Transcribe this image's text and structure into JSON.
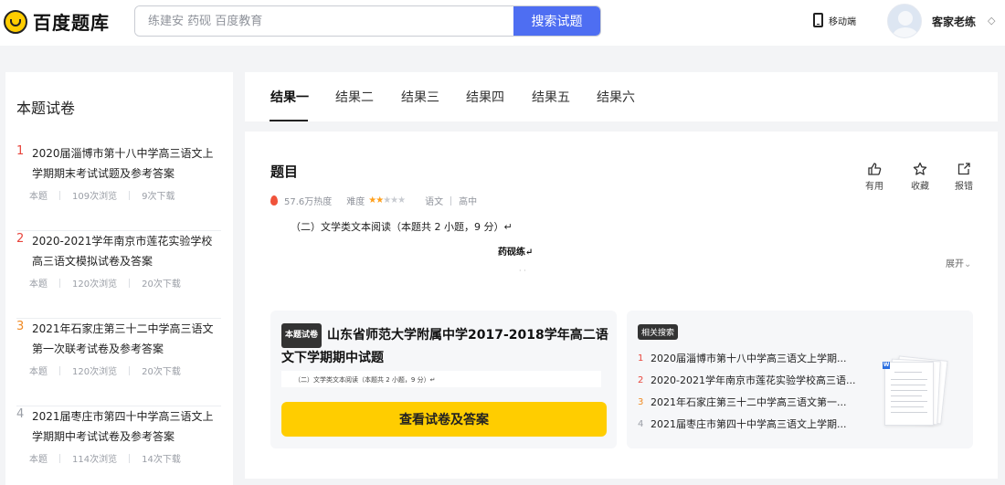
{
  "header": {
    "logo_text": "百度题库",
    "search_placeholder": "练建安 药砚 百度教育",
    "search_button": "搜索试题",
    "mobile_label": "移动端",
    "username": "客家老练"
  },
  "sidebar": {
    "title": "本题试卷",
    "items": [
      {
        "num": "1",
        "num_color": "#e8453c",
        "title": "2020届淄博市第十八中学高三语文上学期期末考试试题及参考答案",
        "type": "本题",
        "views": "109次浏览",
        "downloads": "9次下载"
      },
      {
        "num": "2",
        "num_color": "#e8453c",
        "title": "2020-2021学年南京市莲花实验学校高三语文模拟试卷及答案",
        "type": "本题",
        "views": "120次浏览",
        "downloads": "20次下载"
      },
      {
        "num": "3",
        "num_color": "#f08a24",
        "title": "2021年石家庄第三十二中学高三语文第一次联考试卷及参考答案",
        "type": "本题",
        "views": "120次浏览",
        "downloads": "20次下载"
      },
      {
        "num": "4",
        "num_color": "#9a9ea6",
        "title": "2021届枣庄市第四十中学高三语文上学期期中考试试卷及参考答案",
        "type": "本题",
        "views": "114次浏览",
        "downloads": "14次下载"
      }
    ]
  },
  "tabs": [
    "结果一",
    "结果二",
    "结果三",
    "结果四",
    "结果五",
    "结果六"
  ],
  "question": {
    "title": "题目",
    "heat": "57.6万热度",
    "difficulty_label": "难度",
    "difficulty_stars": 2,
    "difficulty_max": 5,
    "subject": "语文",
    "grade": "高中",
    "body": "（二）文学类文本阅读（本题共 2 小题，9 分）↵",
    "poem_title": "药砚练↵",
    "dots": "· ·",
    "expand": "展开",
    "actions": {
      "useful": "有用",
      "favorite": "收藏",
      "report": "报错"
    }
  },
  "exam_card": {
    "badge": "本题试卷",
    "title": "山东省师范大学附属中学2017-2018学年高二语文下学期期中试题",
    "snippet": "（二）文学类文本阅读（本题共 2 小题，9 分）↵",
    "button": "查看试卷及答案"
  },
  "related": {
    "badge": "相关搜索",
    "items": [
      {
        "num": "1",
        "num_color": "#e8453c",
        "text": "2020届淄博市第十八中学高三语文上学期..."
      },
      {
        "num": "2",
        "num_color": "#e8453c",
        "text": "2020-2021学年南京市莲花实验学校高三语..."
      },
      {
        "num": "3",
        "num_color": "#f08a24",
        "text": "2021年石家庄第三十二中学高三语文第一..."
      },
      {
        "num": "4",
        "num_color": "#9a9ea6",
        "text": "2021届枣庄市第四十中学高三语文上学期..."
      }
    ]
  },
  "colors": {
    "accent": "#4e6ef2",
    "cta": "#ffcd00",
    "star": "#ff9f1a"
  }
}
